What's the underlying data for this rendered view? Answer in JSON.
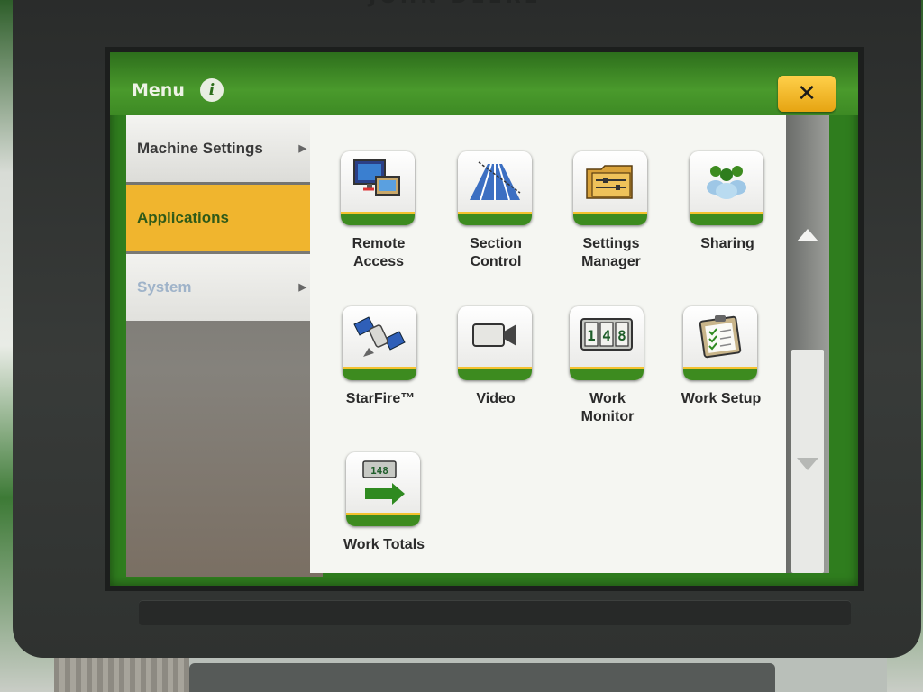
{
  "bezel": {
    "brand": "JOHN DEERE"
  },
  "header": {
    "title": "Menu",
    "info_icon": "info-icon",
    "close_label": "✕"
  },
  "sidebar": {
    "items": [
      {
        "label": "Machine Settings",
        "state": "normal"
      },
      {
        "label": "Applications",
        "state": "active"
      },
      {
        "label": "System",
        "state": "dim"
      }
    ]
  },
  "apps": [
    {
      "label_line1": "Remote",
      "label_line2": "Access",
      "icon": "remote-access-icon"
    },
    {
      "label_line1": "Section",
      "label_line2": "Control",
      "icon": "section-control-icon"
    },
    {
      "label_line1": "Settings",
      "label_line2": "Manager",
      "icon": "settings-manager-icon"
    },
    {
      "label_line1": "Sharing",
      "label_line2": "",
      "icon": "sharing-icon"
    },
    {
      "label_line1": "StarFire™",
      "label_line2": "",
      "icon": "satellite-icon"
    },
    {
      "label_line1": "Video",
      "label_line2": "",
      "icon": "video-camera-icon"
    },
    {
      "label_line1": "Work",
      "label_line2": "Monitor",
      "icon": "work-monitor-icon",
      "digits": "148"
    },
    {
      "label_line1": "Work Setup",
      "label_line2": "",
      "icon": "clipboard-checklist-icon"
    },
    {
      "label_line1": "Work Totals",
      "label_line2": "",
      "icon": "work-totals-icon",
      "digits": "148"
    }
  ],
  "colors": {
    "brand_green": "#3d8b1f",
    "brand_yellow": "#f0b52e"
  }
}
